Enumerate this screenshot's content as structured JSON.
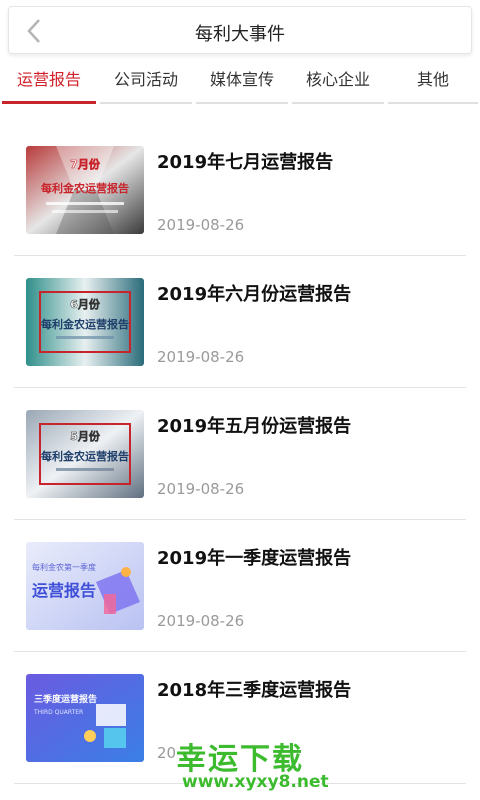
{
  "header": {
    "title": "每利大事件",
    "back_icon": "chevron-left-icon"
  },
  "tabs": [
    {
      "label": "运营报告",
      "active": true
    },
    {
      "label": "公司活动",
      "active": false
    },
    {
      "label": "媒体宣传",
      "active": false
    },
    {
      "label": "核心企业",
      "active": false
    },
    {
      "label": "其他",
      "active": false
    }
  ],
  "items": [
    {
      "title": "2019年七月运营报告",
      "date": "2019-08-26",
      "thumb": {
        "line1": "7月份",
        "line2": "每利金农运营报告"
      }
    },
    {
      "title": "2019年六月份运营报告",
      "date": "2019-08-26",
      "thumb": {
        "line1": "6月份",
        "line2": "每利金农运营报告"
      }
    },
    {
      "title": "2019年五月份运营报告",
      "date": "2019-08-26",
      "thumb": {
        "line1": "5月份",
        "line2": "每利金农运营报告"
      }
    },
    {
      "title": "2019年一季度运营报告",
      "date": "2019-08-26",
      "thumb": {
        "line1": "每利金农第一季度",
        "line2": "运营报告"
      }
    },
    {
      "title": "2018年三季度运营报告",
      "date": "20",
      "thumb": {
        "line1": "三季度运营报告",
        "line2": "THIRD QUARTER"
      }
    }
  ],
  "watermark": {
    "brand": "幸运下载",
    "url": "www.xyxy8.net"
  },
  "colors": {
    "accent": "#c8242c",
    "watermark": "#3dbb2e"
  }
}
